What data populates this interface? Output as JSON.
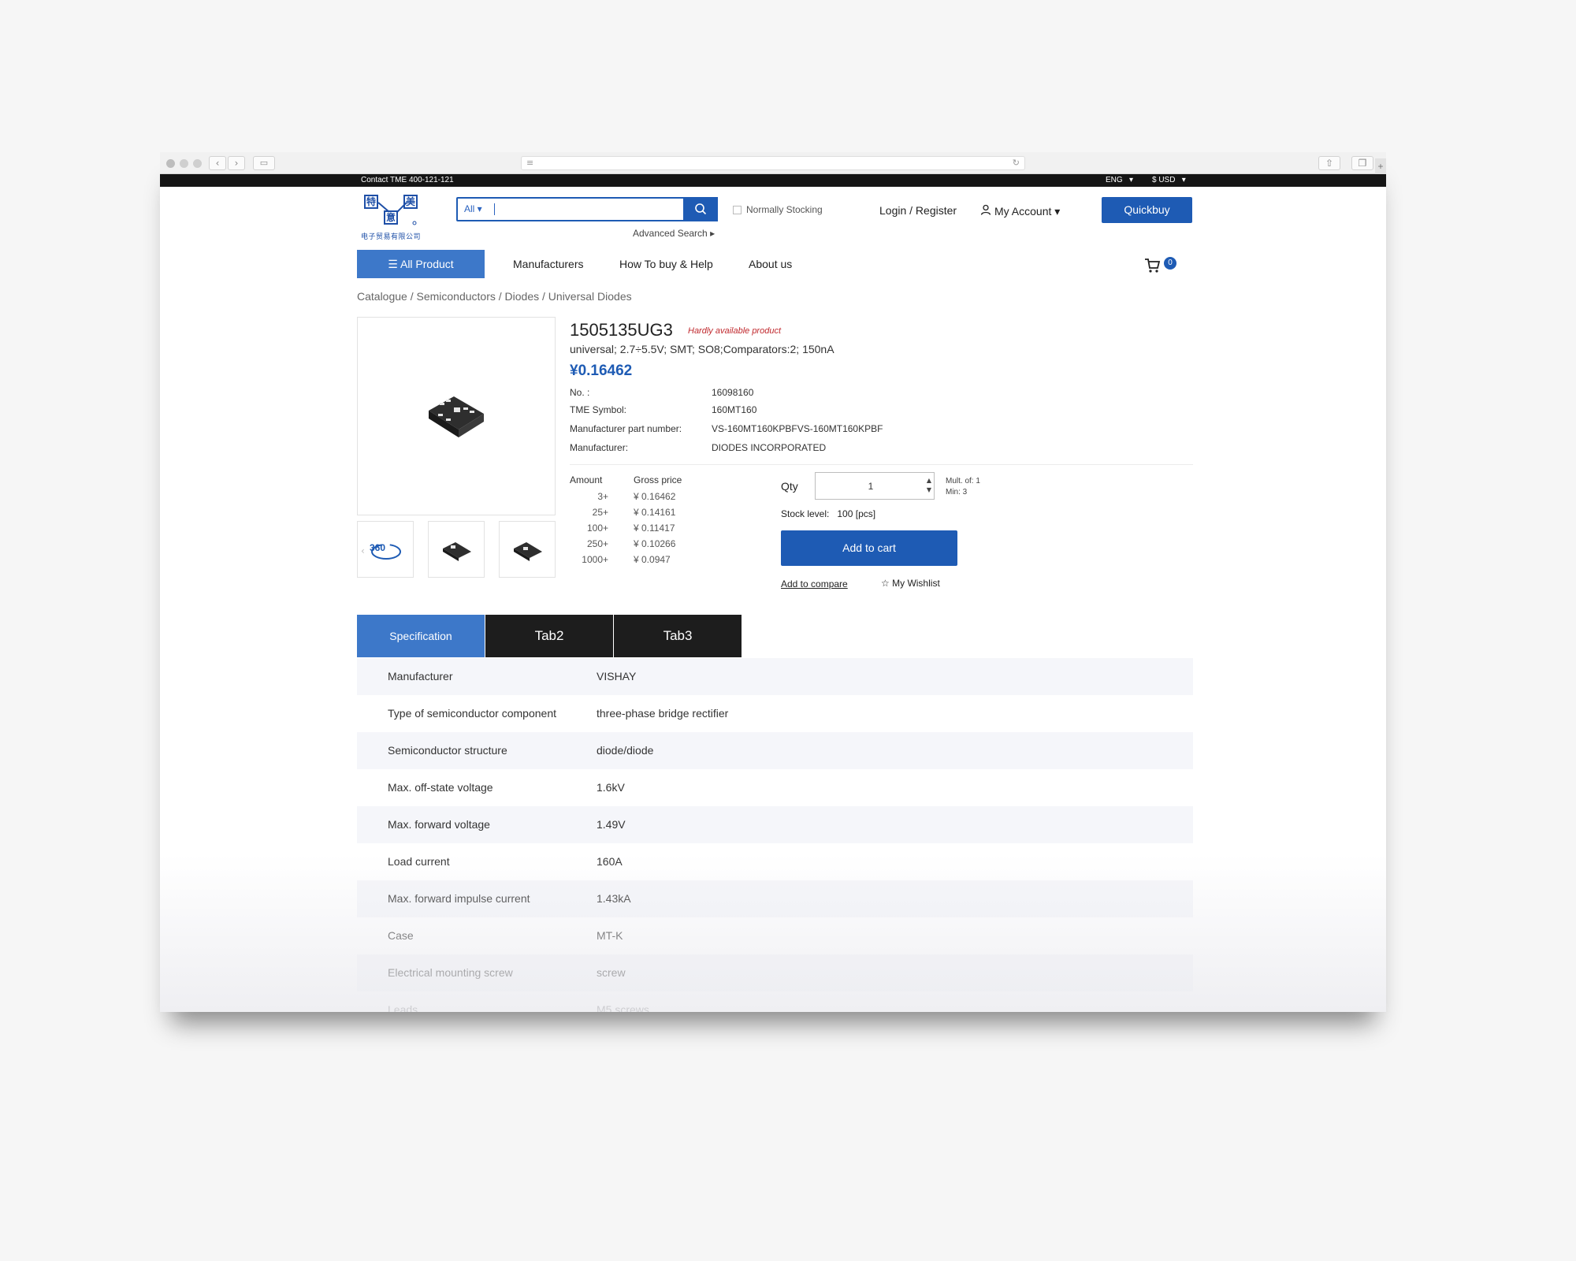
{
  "topbar": {
    "contact": "Contact TME 400-121-121",
    "language": "ENG",
    "currency": "$ USD"
  },
  "logo": {
    "chars": [
      "特",
      "美",
      "意"
    ],
    "subtitle": "电子贸易有限公司"
  },
  "search": {
    "category": "All",
    "advanced": "Advanced Search",
    "normally_stocking": "Normally Stocking"
  },
  "header": {
    "login": "Login / Register",
    "account": "My Account",
    "quickbuy": "Quickbuy"
  },
  "nav": {
    "all_product": "All Product",
    "links": [
      "Manufacturers",
      "How To buy & Help",
      "About us"
    ],
    "cart_count": "0"
  },
  "breadcrumb": "Catalogue / Semiconductors / Diodes / Universal Diodes",
  "product": {
    "title": "1505135UG3",
    "tag": "Hardly available product",
    "description": "universal; 2.7÷5.5V; SMT; SO8;Comparators:2; 150nA",
    "price": "¥0.16462",
    "props": [
      {
        "label": "No. :",
        "value": "16098160"
      },
      {
        "label": "TME Symbol:",
        "value": "160MT160"
      },
      {
        "label": "Manufacturer part number:",
        "value": "VS-160MT160KPBFVS-160MT160KPBF"
      },
      {
        "label": "Manufacturer:",
        "value": "DIODES INCORPORATED"
      }
    ],
    "thumb_360": "360"
  },
  "price_table": {
    "amount_header": "Amount",
    "price_header": "Gross price",
    "rows": [
      {
        "amount": "3+",
        "price": "¥ 0.16462"
      },
      {
        "amount": "25+",
        "price": "¥ 0.14161"
      },
      {
        "amount": "100+",
        "price": "¥ 0.11417"
      },
      {
        "amount": "250+",
        "price": "¥ 0.10266"
      },
      {
        "amount": "1000+",
        "price": "¥ 0.0947"
      }
    ]
  },
  "order": {
    "qty_label": "Qty",
    "qty_value": "1",
    "mult": "Mult. of: 1",
    "min": "Min: 3",
    "stock_label": "Stock level:",
    "stock_value": "100 [pcs]",
    "add_to_cart": "Add to cart",
    "add_to_compare": "Add to compare",
    "wishlist": "My Wishlist"
  },
  "tabs": [
    "Specification",
    "Tab2",
    "Tab3"
  ],
  "spec": [
    {
      "key": "Manufacturer",
      "value": "VISHAY"
    },
    {
      "key": "Type of semiconductor component",
      "value": "three-phase bridge rectifier"
    },
    {
      "key": "Semiconductor structure",
      "value": "diode/diode"
    },
    {
      "key": "Max. off-state voltage",
      "value": "1.6kV"
    },
    {
      "key": "Max. forward voltage",
      "value": "1.49V"
    },
    {
      "key": "Load current",
      "value": "160A"
    },
    {
      "key": "Max. forward impulse current",
      "value": "1.43kA"
    },
    {
      "key": "Case",
      "value": "MT-K"
    },
    {
      "key": "Electrical mounting screw",
      "value": "screw"
    },
    {
      "key": "Leads",
      "value": "M5 screws"
    }
  ],
  "colors": {
    "brand_blue": "#1e5bb4",
    "tab_active": "#3d78c9",
    "tag_red": "#c0282d"
  }
}
